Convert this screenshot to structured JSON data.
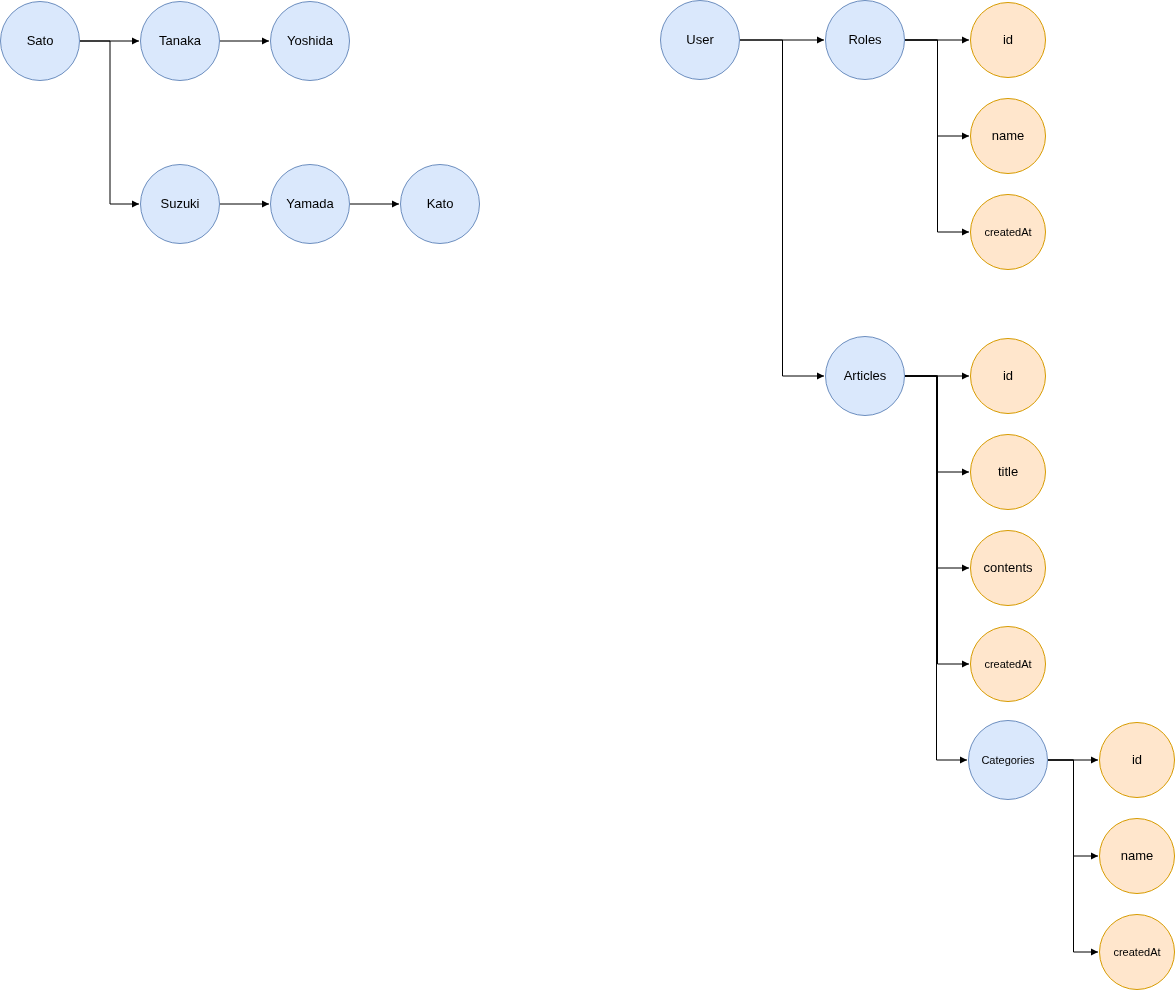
{
  "diagrams": [
    {
      "root": {
        "label": "Sato",
        "kind": "entity",
        "children": [
          {
            "label": "Tanaka",
            "kind": "entity",
            "children": [
              {
                "label": "Yoshida",
                "kind": "entity"
              }
            ]
          },
          {
            "label": "Suzuki",
            "kind": "entity",
            "children": [
              {
                "label": "Yamada",
                "kind": "entity",
                "children": [
                  {
                    "label": "Kato",
                    "kind": "entity"
                  }
                ]
              }
            ]
          }
        ]
      }
    },
    {
      "root": {
        "label": "User",
        "kind": "entity",
        "children": [
          {
            "label": "Roles",
            "kind": "entity",
            "children": [
              {
                "label": "id",
                "kind": "field"
              },
              {
                "label": "name",
                "kind": "field"
              },
              {
                "label": "createdAt",
                "kind": "field"
              }
            ]
          },
          {
            "label": "Articles",
            "kind": "entity",
            "children": [
              {
                "label": "id",
                "kind": "field"
              },
              {
                "label": "title",
                "kind": "field"
              },
              {
                "label": "contents",
                "kind": "field"
              },
              {
                "label": "createdAt",
                "kind": "field"
              },
              {
                "label": "Categories",
                "kind": "entity",
                "children": [
                  {
                    "label": "id",
                    "kind": "field"
                  },
                  {
                    "label": "name",
                    "kind": "field"
                  },
                  {
                    "label": "createdAt",
                    "kind": "field"
                  }
                ]
              }
            ]
          }
        ]
      }
    }
  ]
}
